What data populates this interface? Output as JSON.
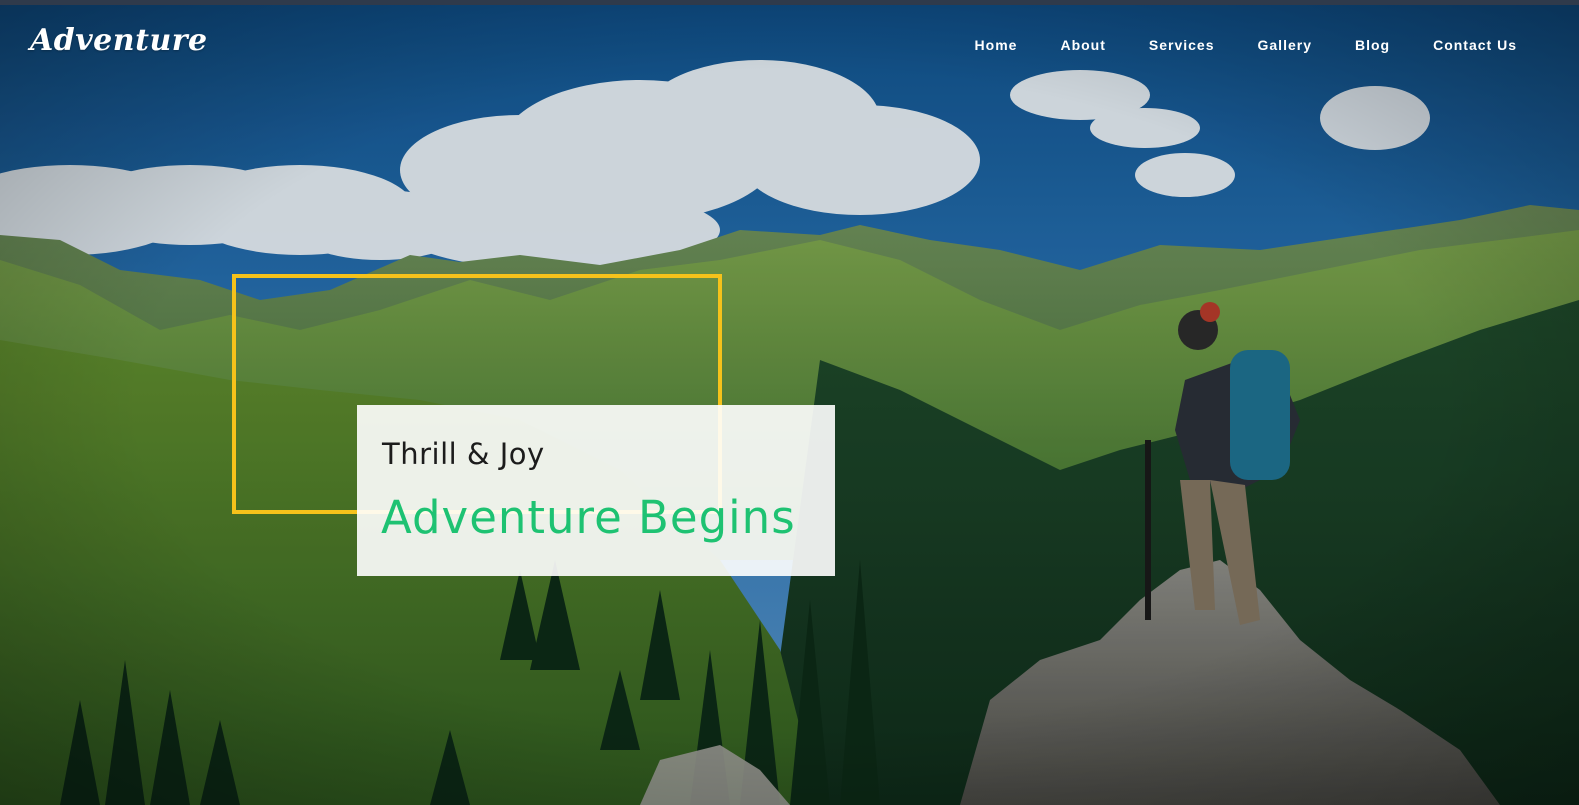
{
  "header": {
    "logo": "Adventure",
    "nav": [
      {
        "label": "Home"
      },
      {
        "label": "About"
      },
      {
        "label": "Services"
      },
      {
        "label": "Gallery"
      },
      {
        "label": "Blog"
      },
      {
        "label": "Contact Us"
      }
    ]
  },
  "hero": {
    "kicker": "Thrill & Joy",
    "title": "Adventure Begins",
    "frame_color": "#f5c21b",
    "title_color": "#1ec272"
  },
  "colors": {
    "topbar": "#2f3a4b",
    "sky": "#1a5d97",
    "nav_text": "#ffffff"
  }
}
